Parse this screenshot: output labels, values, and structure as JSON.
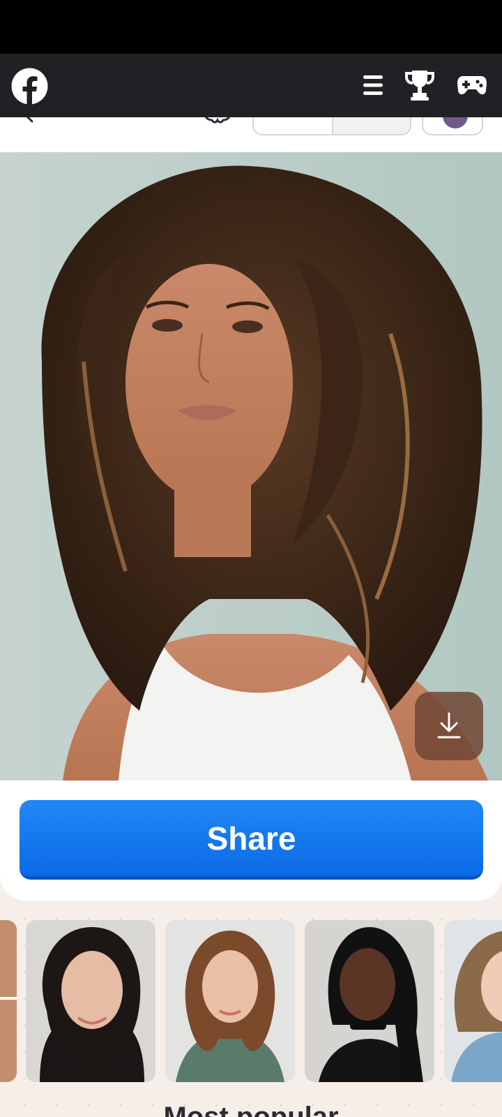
{
  "app": {
    "logo_icon": "facebook-icon",
    "header_icons": [
      "menu-icon",
      "trophy-icon",
      "gamepad-icon"
    ]
  },
  "peek": {
    "icons": [
      "chevron-left-icon",
      "gear-icon",
      "chat-bubble-icon"
    ]
  },
  "result": {
    "image_alt": "Portrait of a woman with long curly brown hair and a white tank top",
    "download_icon": "download-icon",
    "share_label": "Share"
  },
  "gallery": {
    "items": [
      {
        "alt": "Portrait partially visible"
      },
      {
        "alt": "Woman with shoulder-length dark wavy hair"
      },
      {
        "alt": "Woman with long wavy auburn hair and green sweater"
      },
      {
        "alt": "Woman with long black braids and choker"
      },
      {
        "alt": "Woman with long light-brown wavy hair"
      }
    ],
    "section_title": "Most popular"
  },
  "colors": {
    "accent": "#1877F2",
    "header_bg": "#202124",
    "download_bg": "#6E4632"
  }
}
